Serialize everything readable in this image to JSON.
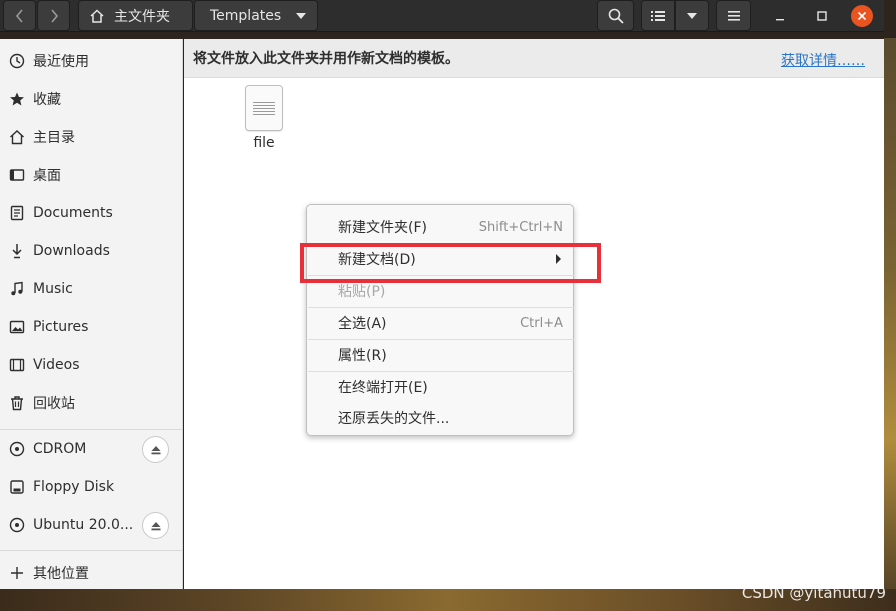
{
  "window": {
    "path": {
      "home": "主文件夹",
      "current": "Templates"
    }
  },
  "sidebar": {
    "items": [
      {
        "label": "最近使用",
        "icon": "clock-icon"
      },
      {
        "label": "收藏",
        "icon": "star-icon"
      },
      {
        "label": "主目录",
        "icon": "home-icon"
      },
      {
        "label": "桌面",
        "icon": "desktop-icon"
      },
      {
        "label": "Documents",
        "icon": "document-icon"
      },
      {
        "label": "Downloads",
        "icon": "download-icon"
      },
      {
        "label": "Music",
        "icon": "music-icon"
      },
      {
        "label": "Pictures",
        "icon": "picture-icon"
      },
      {
        "label": "Videos",
        "icon": "video-icon"
      },
      {
        "label": "回收站",
        "icon": "trash-icon"
      }
    ],
    "devices": [
      {
        "label": "CDROM",
        "icon": "disc-icon",
        "ejectable": true
      },
      {
        "label": "Floppy Disk",
        "icon": "drive-icon",
        "ejectable": false
      },
      {
        "label": "Ubuntu 20.0...",
        "icon": "disc-icon",
        "ejectable": true
      }
    ],
    "other": {
      "label": "其他位置",
      "icon": "plus-icon"
    }
  },
  "infobar": {
    "text": "将文件放入此文件夹并用作新文档的模板。",
    "link": "获取详情……"
  },
  "files": [
    {
      "name": "file",
      "icon": "text-file-icon"
    }
  ],
  "context_menu": {
    "items": [
      {
        "label": "新建文件夹(F)",
        "accel": "Shift+Ctrl+N",
        "disabled": false
      },
      {
        "label": "新建文档(D)",
        "accel": "",
        "submenu": true,
        "disabled": false
      },
      {
        "label": "粘贴(P)",
        "accel": "",
        "disabled": true
      },
      {
        "label": "全选(A)",
        "accel": "Ctrl+A",
        "disabled": false
      },
      {
        "label": "属性(R)",
        "accel": "",
        "disabled": false
      },
      {
        "label": "在终端打开(E)",
        "accel": "",
        "disabled": false
      },
      {
        "label": "还原丢失的文件...",
        "accel": "",
        "disabled": false
      }
    ]
  },
  "watermark": "CSDN @yitahutu79",
  "colors": {
    "headerbar": "#2d2d2d",
    "accent_close": "#e95420",
    "link": "#2a76c6",
    "annotation_box": "#e8303a"
  }
}
